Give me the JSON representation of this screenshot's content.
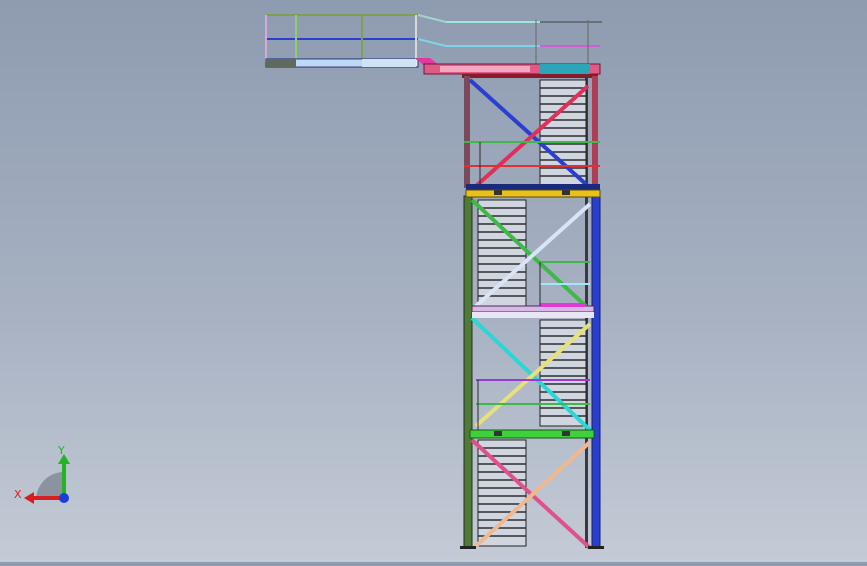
{
  "viewport": {
    "background_top": "#8e9bb0",
    "background_bottom": "#c4cbd6",
    "model": "steel-stair-tower-with-walkway"
  },
  "triad": {
    "x_label": "X",
    "y_label": "Y",
    "x_color": "#d81e1e",
    "y_color": "#23b423",
    "z_color": "#1a3fd8"
  },
  "colors": {
    "column_left": "#4f7a3a",
    "column_right": "#2a3fd0",
    "deck_top": "#e05a86",
    "deck_mid_yellow": "#e8c21a",
    "deck_mid_lilac": "#d9b7e6",
    "deck_green": "#3fd13c",
    "walkway_rail": "#7fa04f",
    "stair_tread": "#2d2d2d"
  }
}
